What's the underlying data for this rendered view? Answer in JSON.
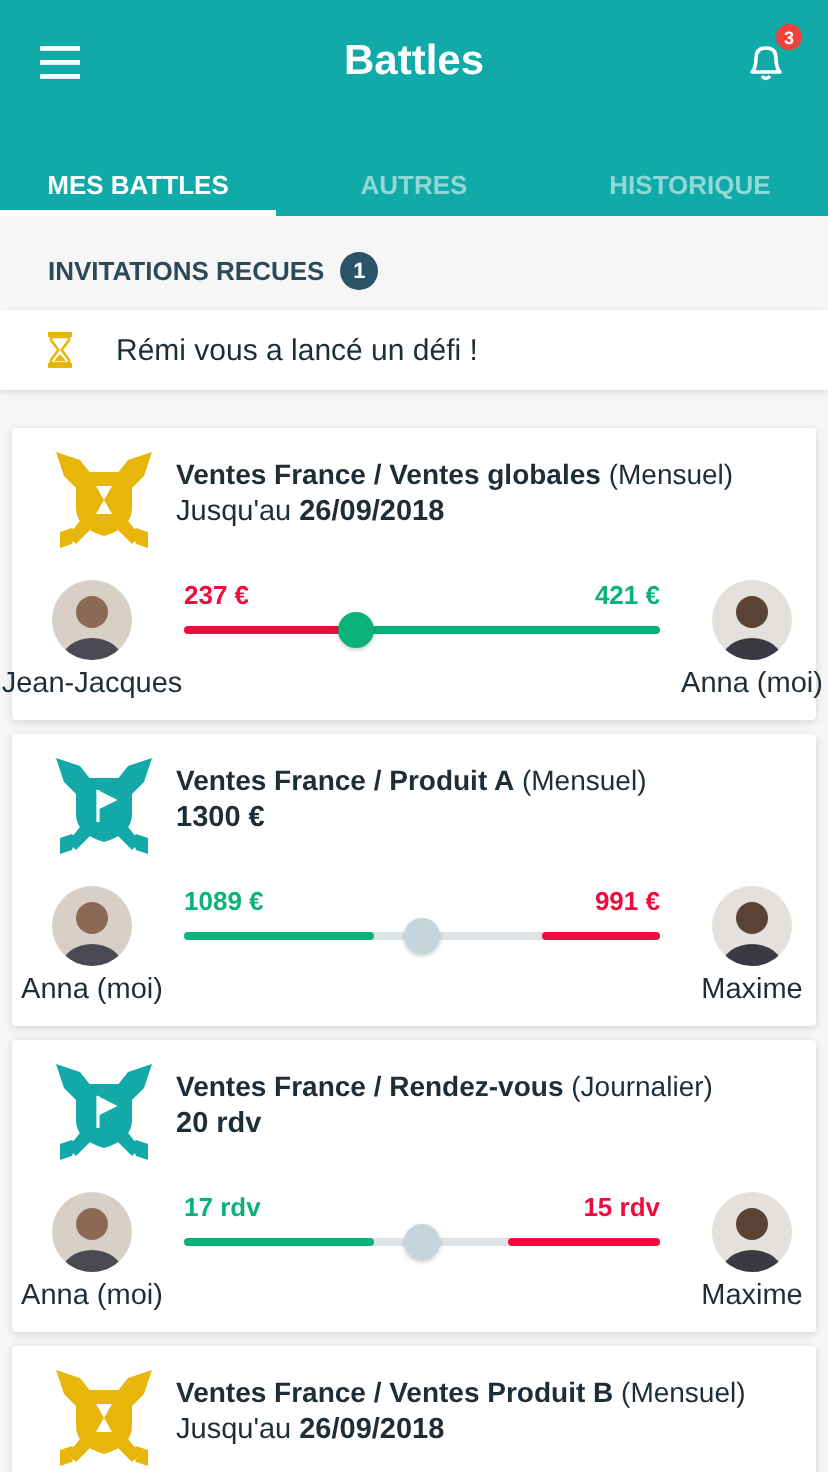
{
  "header": {
    "title": "Battles",
    "notifications": "3"
  },
  "tabs": [
    {
      "label": "MES BATTLES",
      "selected": true
    },
    {
      "label": "AUTRES",
      "selected": false
    },
    {
      "label": "HISTORIQUE",
      "selected": false
    }
  ],
  "invitations": {
    "heading": "INVITATIONS RECUES",
    "count": "1",
    "items": [
      {
        "text": "Rémi vous a lancé un défi !"
      }
    ]
  },
  "battles": [
    {
      "kind": "pending",
      "title": "**Ventes France / Ventes globales** (Mensuel)",
      "subtitle": {
        "prefix": "Jusqu'au",
        "value": "26/09/2018"
      },
      "left": {
        "name": "Jean-Jacques",
        "score": "237 €",
        "leading": false,
        "level": 0.36
      },
      "right": {
        "name": "Anna (moi)",
        "score": "421 €",
        "leading": true,
        "level": 0.64
      }
    },
    {
      "kind": "active",
      "title": "**Ventes France / Produit A** (Mensuel)",
      "subtitle": {
        "value": "1300 €"
      },
      "left": {
        "name": "Anna (moi)",
        "score": "1089 €",
        "leading": true,
        "level": 0.4
      },
      "right": {
        "name": "Maxime",
        "score": "991 €",
        "leading": false,
        "level": 0.25
      }
    },
    {
      "kind": "active",
      "title": "**Ventes France / Rendez-vous** (Journalier)",
      "subtitle": {
        "value": "20 rdv"
      },
      "left": {
        "name": "Anna (moi)",
        "score": "17 rdv",
        "leading": true,
        "level": 0.4
      },
      "right": {
        "name": "Maxime",
        "score": "15 rdv",
        "leading": false,
        "level": 0.32
      }
    },
    {
      "kind": "pending",
      "title": "**Ventes France / Ventes Produit B** (Mensuel)",
      "subtitle": {
        "prefix": "Jusqu'au",
        "value": "26/09/2018"
      }
    }
  ]
}
